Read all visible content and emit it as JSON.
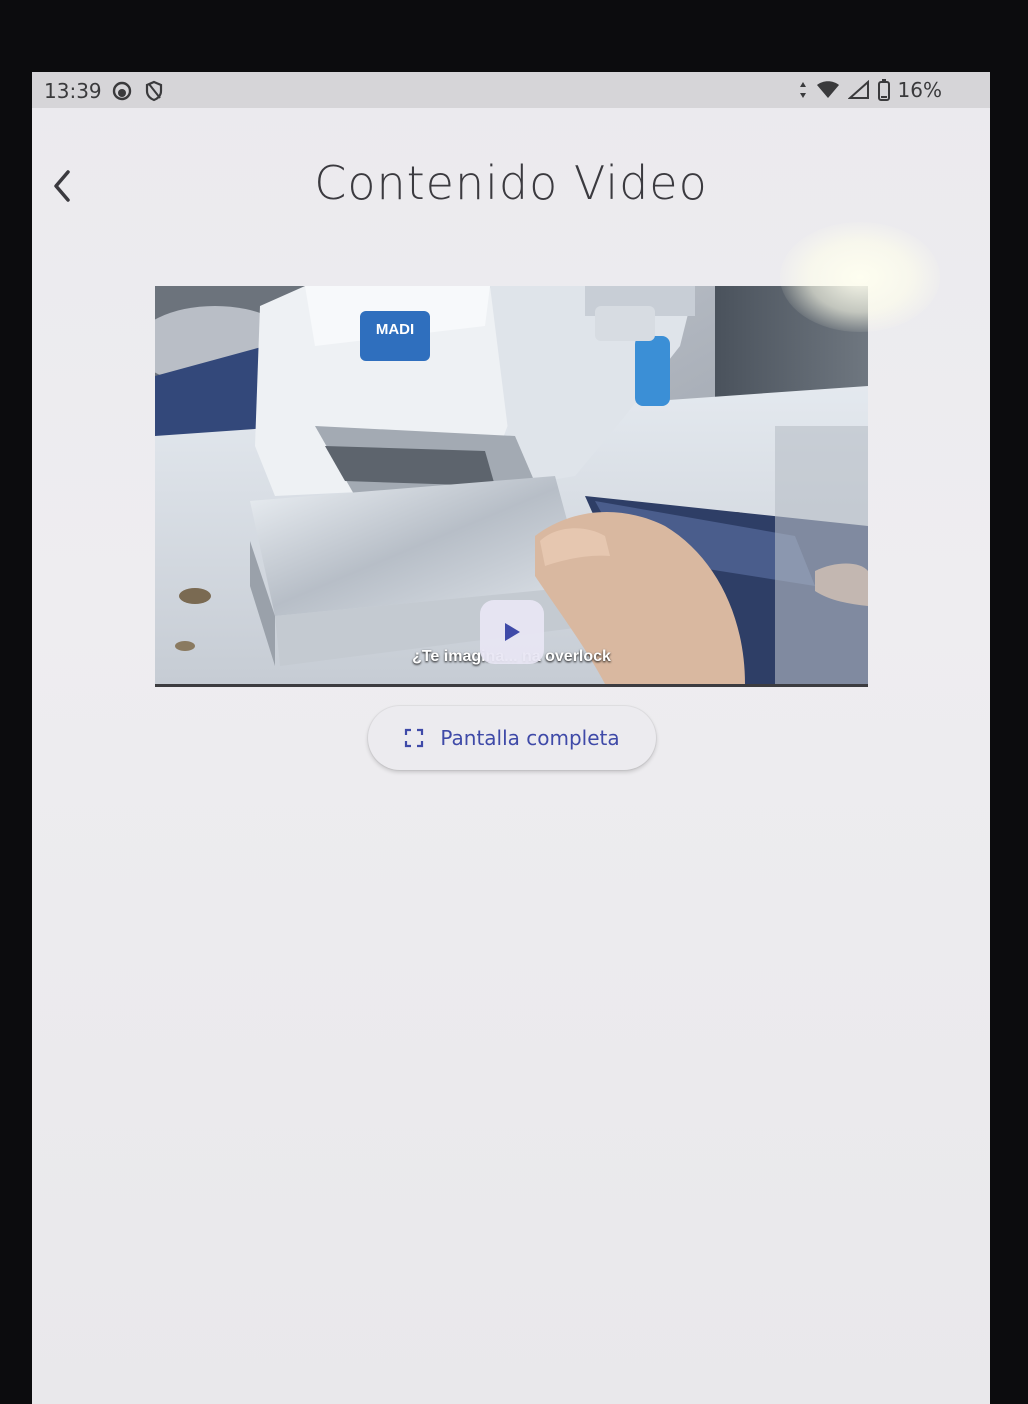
{
  "status_bar": {
    "time": "13:39",
    "battery": "16%",
    "icons": [
      "notification-icon",
      "vpn-icon",
      "data-arrows-icon",
      "wifi-icon",
      "signal-icon",
      "battery-icon"
    ]
  },
  "header": {
    "title": "Contenido Video",
    "back_icon": "chevron-left-icon"
  },
  "video": {
    "subtitle": "¿Te imagina... na overlock",
    "brand_label": "MADI",
    "play_icon": "play-icon"
  },
  "fullscreen_button": {
    "label": "Pantalla completa",
    "icon": "fullscreen-icon"
  },
  "colors": {
    "accent": "#3f4aa8",
    "background": "#ecebef",
    "status_bar": "#d6d5d8"
  }
}
